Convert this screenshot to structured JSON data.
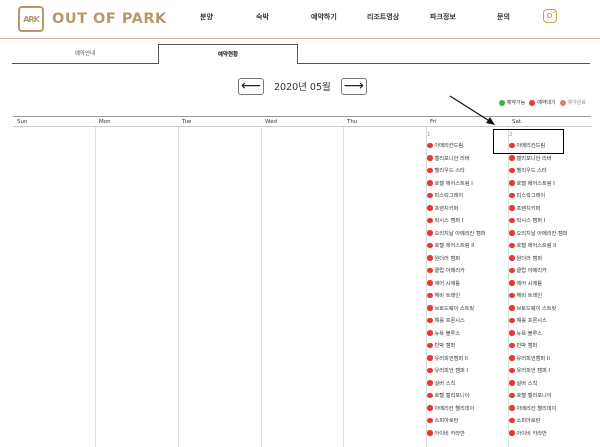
{
  "header": {
    "logo_text": "OUT OF PARK",
    "logo_mark_text": "ARK",
    "nav": [
      "분양",
      "숙박",
      "예약하기",
      "리조트영상",
      "파크정보",
      "문의"
    ],
    "instagram_icon": "instagram-icon"
  },
  "tabs": [
    "예약안내",
    "예약현황"
  ],
  "calendar": {
    "month_label": "2020년 05월",
    "prev_icon": "arrow-left-icon",
    "next_icon": "arrow-right-icon",
    "weekdays": [
      "Sun",
      "Mon",
      "Tue",
      "Wed",
      "Thu",
      "Fri",
      "Sat."
    ],
    "legend": [
      {
        "label": "예약가능",
        "color": "#3cb043"
      },
      {
        "label": "예약대기",
        "color": "#e53935"
      },
      {
        "label": "예약완료",
        "color": "#e8766f"
      }
    ],
    "fri": {
      "day": "1",
      "items": [
        "아메리칸드림",
        "캘리포니안 리버",
        "헬리우드 스타",
        "호텔 에어스트림 I",
        "미스릭그레이",
        "프렌치키퍼",
        "락시스 캠퍼 I",
        "오리지날 아메리칸 캠퍼",
        "호텔 에어스트림 II",
        "원더러 캠퍼",
        "클럽 아메리카",
        "에어 시애틀",
        "헤비 트레인",
        "브로드웨이 스트릿",
        "해롤 프론시스",
        "뉴욕 블루스",
        "빈박 캠퍼",
        "유러피언캠퍼 II",
        "유러피언 캠퍼 I",
        "실버 스칙",
        "호텔 캘리포니아",
        "아메리칸 헬리데이",
        "소피아로란",
        "아이비 카라반"
      ]
    },
    "sat": {
      "day": "2",
      "items": [
        "아메리칸드림",
        "캘리포니안 리버",
        "헬리우드 스타",
        "호텔 에어스트림 I",
        "미스릭그레이",
        "프렌치키퍼",
        "락시스 캠퍼 I",
        "오리지날 아메리칸 캠퍼",
        "호텔 에어스트림 II",
        "원더러 캠퍼",
        "클럽 아메리카",
        "에어 시애틀",
        "헤비 트레인",
        "브로드웨이 스트릿",
        "해롤 프론시스",
        "뉴욕 블루스",
        "빈박 캠퍼",
        "유러피언캠퍼 II",
        "유러피언 캠퍼 I",
        "실버 스칙",
        "호텔 캘리포니아",
        "아메리칸 헬리데이",
        "소피아로란",
        "아이비 카라반"
      ]
    },
    "status_color": "#e53935"
  }
}
